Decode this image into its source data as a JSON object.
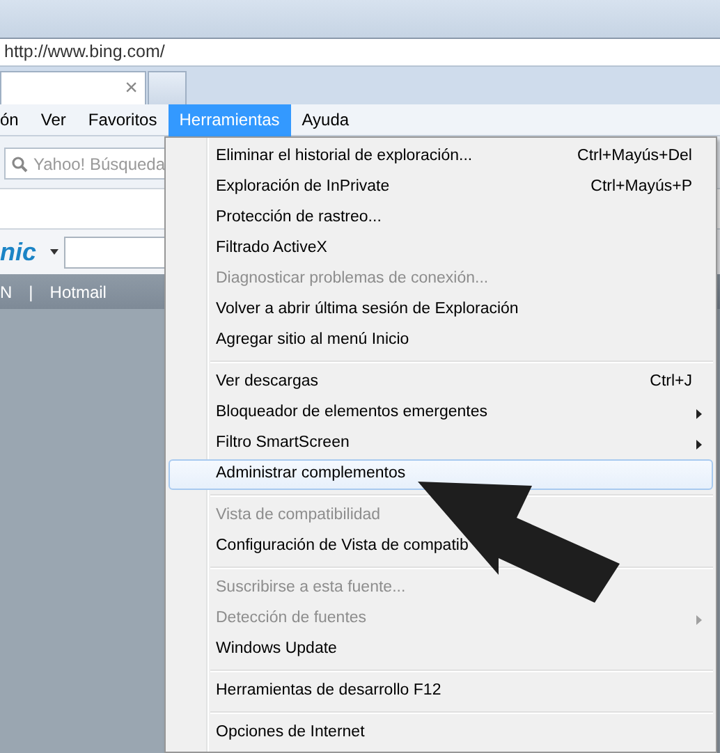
{
  "address_bar": {
    "url": "http://www.bing.com/"
  },
  "tab": {
    "close": "×"
  },
  "menu_bar": [
    {
      "label": "ón",
      "selected": false
    },
    {
      "label": "Ver",
      "selected": false
    },
    {
      "label": "Favoritos",
      "selected": false
    },
    {
      "label": "Herramientas",
      "selected": true
    },
    {
      "label": "Ayuda",
      "selected": false
    }
  ],
  "search": {
    "placeholder": "Yahoo! Búsqueda"
  },
  "brand_fragment": "nic",
  "links": [
    {
      "label": "N"
    },
    {
      "label": "|"
    },
    {
      "label": "Hotmail"
    }
  ],
  "menu": [
    {
      "kind": "item",
      "label": "Eliminar el historial de exploración...",
      "shortcut": "Ctrl+Mayús+Del",
      "disabled": false,
      "submenu": false,
      "selected": false
    },
    {
      "kind": "item",
      "label": "Exploración de InPrivate",
      "shortcut": "Ctrl+Mayús+P",
      "disabled": false,
      "submenu": false,
      "selected": false
    },
    {
      "kind": "item",
      "label": "Protección de rastreo...",
      "disabled": false,
      "submenu": false,
      "selected": false
    },
    {
      "kind": "item",
      "label": "Filtrado ActiveX",
      "disabled": false,
      "submenu": false,
      "selected": false
    },
    {
      "kind": "item",
      "label": "Diagnosticar problemas de conexión...",
      "disabled": true,
      "submenu": false,
      "selected": false
    },
    {
      "kind": "item",
      "label": "Volver a abrir última sesión de Exploración",
      "disabled": false,
      "submenu": false,
      "selected": false
    },
    {
      "kind": "item",
      "label": "Agregar sitio al menú Inicio",
      "disabled": false,
      "submenu": false,
      "selected": false
    },
    {
      "kind": "separator"
    },
    {
      "kind": "item",
      "label": "Ver descargas",
      "shortcut": "Ctrl+J",
      "disabled": false,
      "submenu": false,
      "selected": false
    },
    {
      "kind": "item",
      "label": "Bloqueador de elementos emergentes",
      "disabled": false,
      "submenu": true,
      "selected": false
    },
    {
      "kind": "item",
      "label": "Filtro SmartScreen",
      "disabled": false,
      "submenu": true,
      "selected": false
    },
    {
      "kind": "item",
      "label": "Administrar complementos",
      "disabled": false,
      "submenu": false,
      "selected": true
    },
    {
      "kind": "separator"
    },
    {
      "kind": "item",
      "label": "Vista de compatibilidad",
      "disabled": true,
      "submenu": false,
      "selected": false
    },
    {
      "kind": "item",
      "label": "Configuración de Vista de compatib",
      "disabled": false,
      "submenu": false,
      "selected": false
    },
    {
      "kind": "separator"
    },
    {
      "kind": "item",
      "label": "Suscribirse a esta fuente...",
      "disabled": true,
      "submenu": false,
      "selected": false
    },
    {
      "kind": "item",
      "label": "Detección de fuentes",
      "disabled": true,
      "submenu": true,
      "selected": false
    },
    {
      "kind": "item",
      "label": "Windows Update",
      "disabled": false,
      "submenu": false,
      "selected": false
    },
    {
      "kind": "separator"
    },
    {
      "kind": "item",
      "label": "Herramientas de desarrollo F12",
      "disabled": false,
      "submenu": false,
      "selected": false
    },
    {
      "kind": "separator"
    },
    {
      "kind": "item",
      "label": "Opciones de Internet",
      "disabled": false,
      "submenu": false,
      "selected": false
    }
  ]
}
